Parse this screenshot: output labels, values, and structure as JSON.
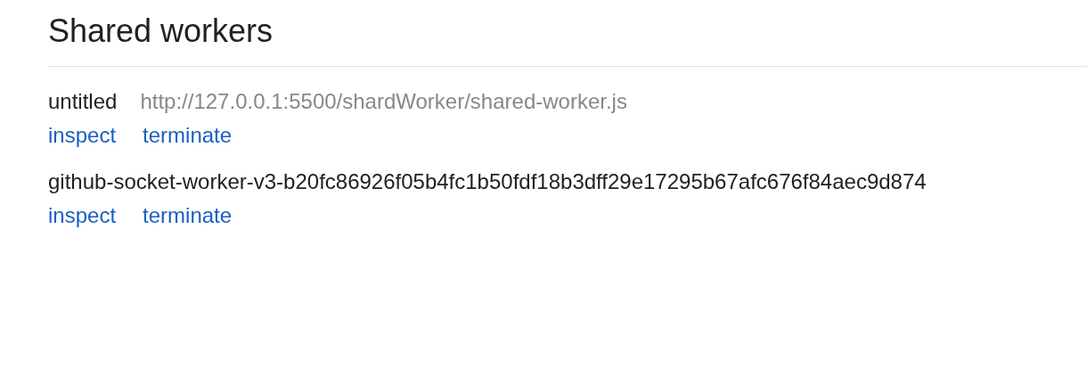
{
  "title": "Shared workers",
  "workers": [
    {
      "name": "untitled",
      "url": "http://127.0.0.1:5500/shardWorker/shared-worker.js",
      "actions": [
        "inspect",
        "terminate"
      ]
    },
    {
      "name": "github-socket-worker-v3-b20fc86926f05b4fc1b50fdf18b3dff29e17295b67afc676f84aec9d874",
      "actions": [
        "inspect",
        "terminate"
      ]
    }
  ]
}
